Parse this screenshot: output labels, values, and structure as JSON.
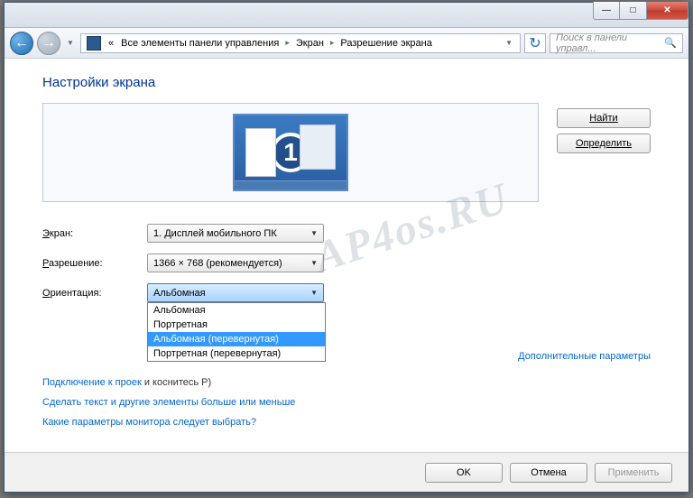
{
  "titlebar": {
    "min": "—",
    "max": "□",
    "close": "✕"
  },
  "nav": {
    "back_arrow": "←",
    "fwd_arrow": "→",
    "dd_arrow": "▼",
    "refresh": "↻"
  },
  "breadcrumb": {
    "prefix": "«",
    "seg1": "Все элементы панели управления",
    "seg2": "Экран",
    "seg3": "Разрешение экрана",
    "arrow": "▸",
    "dd": "▼"
  },
  "search": {
    "placeholder": "Поиск в панели управл...",
    "icon": "🔍"
  },
  "page": {
    "title": "Настройки экрана",
    "monitor_number": "1"
  },
  "buttons": {
    "find": "Найти",
    "detect": "Определить",
    "ok": "OK",
    "cancel": "Отмена",
    "apply": "Применить"
  },
  "form": {
    "screen_label_u": "Э",
    "screen_label_rest": "кран:",
    "screen_value": "1. Дисплей мобильного ПК",
    "resolution_label_u": "Р",
    "resolution_label_rest": "азрешение:",
    "resolution_value": "1366 × 768 (рекомендуется)",
    "orientation_label_u": "О",
    "orientation_label_rest": "риентация:",
    "orientation_value": "Альбомная",
    "orientation_options": {
      "o0": "Альбомная",
      "o1": "Портретная",
      "o2": "Альбомная (перевернутая)",
      "o3": "Портретная (перевернутая)"
    },
    "combo_arrow": "▼"
  },
  "links": {
    "advanced": "Дополнительные параметры",
    "projector_pre": "Подключение к проек",
    "projector_post": " и коснитесь P)",
    "text_size": "Сделать текст и другие элементы больше или меньше",
    "which_monitor": "Какие параметры монитора следует выбрать?"
  },
  "watermark": "AP4os.RU"
}
